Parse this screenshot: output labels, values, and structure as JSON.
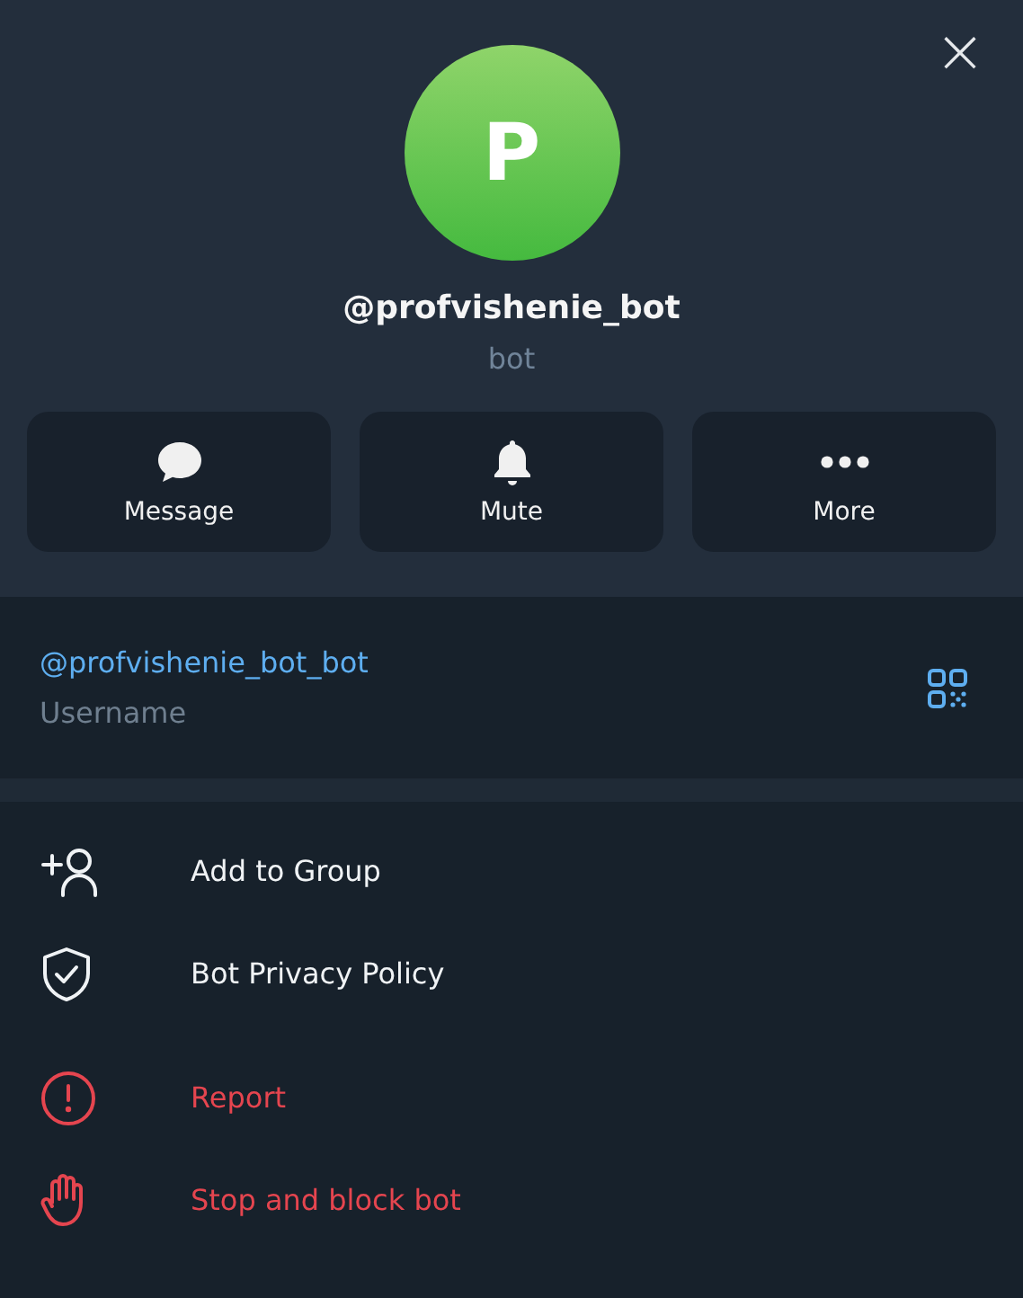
{
  "close_button": {
    "label": "×"
  },
  "profile": {
    "initial": "P",
    "name": "@profvishenie_bot",
    "subtitle": "bot"
  },
  "quick_actions": [
    {
      "label": "Message"
    },
    {
      "label": "Mute"
    },
    {
      "label": "More"
    }
  ],
  "username": {
    "value": "@profvishenie_bot_bot",
    "caption": "Username"
  },
  "action_groups": [
    [
      {
        "label": "Add to Group",
        "kind": "normal"
      },
      {
        "label": "Bot Privacy Policy",
        "kind": "normal"
      }
    ],
    [
      {
        "label": "Report",
        "kind": "danger"
      },
      {
        "label": "Stop and block bot",
        "kind": "danger"
      }
    ]
  ]
}
